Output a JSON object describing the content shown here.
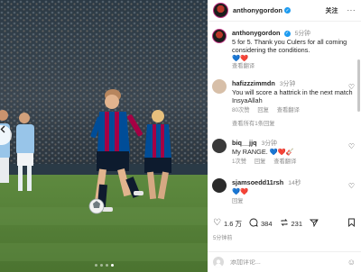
{
  "post": {
    "author": "anthonygordon",
    "follow_label": "关注",
    "more_label": "···",
    "caption": {
      "username": "anthonygordon",
      "time": "5分钟",
      "text": "5 for 5. Thank you Culers for all coming considering the conditions.",
      "emojis": "💙❤️",
      "translate_label": "查看翻译"
    }
  },
  "comments": [
    {
      "username": "hafizzzimmdn",
      "time": "3分钟",
      "text": "You will score a hattrick in the next match InsyaAllah",
      "likes": "80次赞",
      "reply_label": "回复",
      "translate_label": "查看翻译",
      "avatar_color": "#d7bfa8"
    },
    {
      "username": "biq__jjq",
      "time": "3分钟",
      "text": "My RANGE.",
      "emojis": "💙❤️🎸",
      "likes": "1次赞",
      "reply_label": "回复",
      "translate_label": "查看翻译",
      "avatar_color": "#3a3a3a"
    },
    {
      "username": "sjamsoedd11rsh",
      "time": "14秒",
      "emojis": "💙❤️",
      "reply_label": "回复",
      "avatar_color": "#2b2b2b"
    }
  ],
  "view_all_replies": "查看所有1条回复",
  "stats": {
    "likes": "1.6 万",
    "comments": "384",
    "reposts": "231"
  },
  "timestamp": "5分钟前",
  "add_comment_placeholder": "添加评论...",
  "carousel": {
    "count": 4,
    "active": 3
  },
  "colors": {
    "verified": "#1d9bf0",
    "barca_blue": "#004d98",
    "barca_red": "#a50044",
    "city_blue": "#98c5e9",
    "pitch": "#55803a"
  }
}
